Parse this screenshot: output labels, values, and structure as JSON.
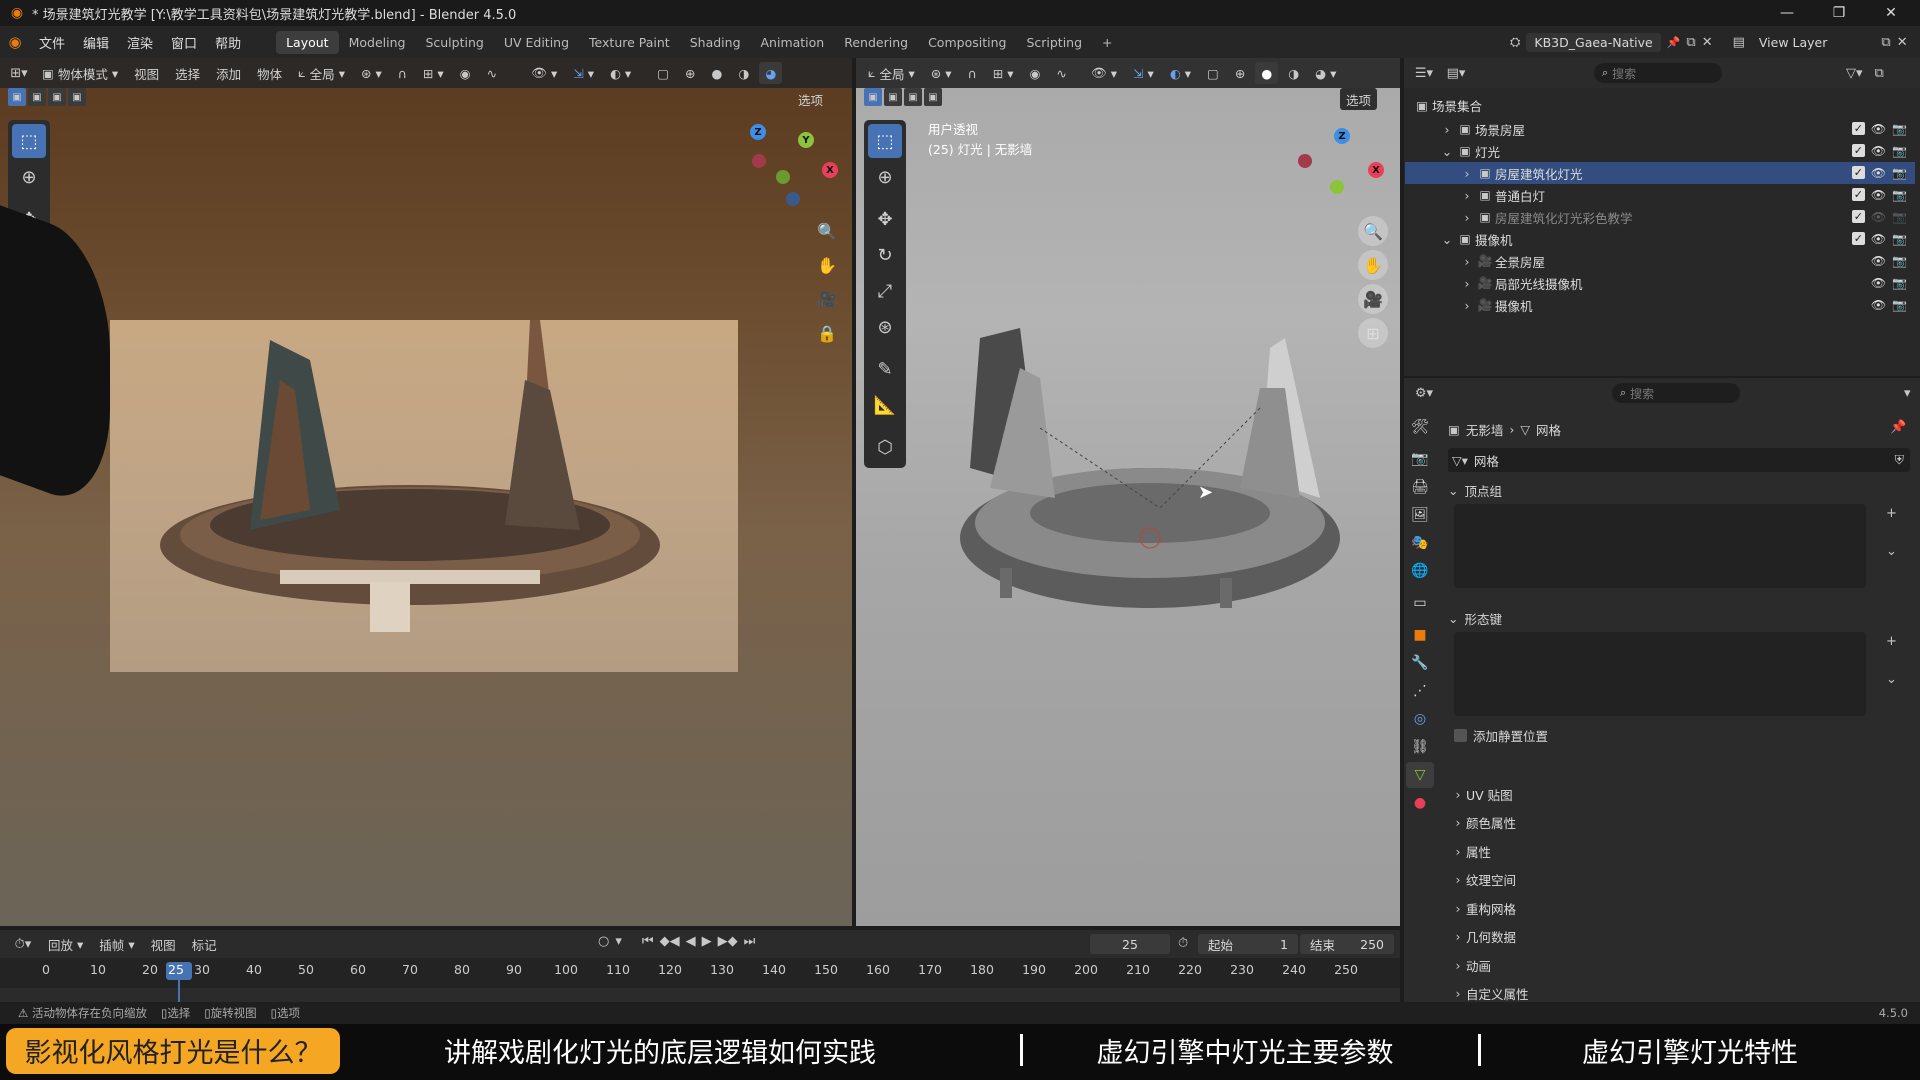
{
  "window": {
    "title": "* 场景建筑灯光教学 [Y:\\教学工具资料包\\场景建筑灯光教学.blend] - Blender 4.5.0",
    "minimize": "—",
    "maximize": "❐",
    "close": "✕"
  },
  "menu": {
    "items": [
      "文件",
      "编辑",
      "渲染",
      "窗口",
      "帮助"
    ],
    "workspaces": [
      "Layout",
      "Modeling",
      "Sculpting",
      "UV Editing",
      "Texture Paint",
      "Shading",
      "Animation",
      "Rendering",
      "Compositing",
      "Scripting"
    ],
    "add_tab": "+",
    "scene": "KB3D_Gaea-Native",
    "view_layer": "View Layer"
  },
  "viewport_left": {
    "mode": "物体模式",
    "menus": [
      "视图",
      "选择",
      "添加",
      "物体"
    ],
    "transform": "全局",
    "options": "选项"
  },
  "viewport_right": {
    "transform": "全局",
    "options": "选项",
    "view_name": "用户透视",
    "view_info": "(25) 灯光 | 无影墙"
  },
  "outliner": {
    "search_placeholder": "搜索",
    "root": "场景集合",
    "rows": [
      {
        "label": "场景房屋",
        "selected": false
      },
      {
        "label": "灯光",
        "selected": false
      },
      {
        "label": "房屋建筑化灯光",
        "selected": true
      },
      {
        "label": "普通白灯",
        "selected": false
      },
      {
        "label": "房屋建筑化灯光彩色教学",
        "selected": false
      },
      {
        "label": "摄像机",
        "selected": false
      },
      {
        "label": "全景房屋",
        "selected": false
      },
      {
        "label": "局部光线摄像机",
        "selected": false
      },
      {
        "label": "摄像机",
        "selected": false
      }
    ]
  },
  "properties": {
    "search_placeholder": "搜索",
    "breadcrumb_object": "无影墙",
    "breadcrumb_data": "网格",
    "data_name": "网格",
    "vertex_groups": "顶点组",
    "shape_keys": "形态键",
    "add_rest_position": "添加静置位置",
    "panels": [
      "UV 贴图",
      "颜色属性",
      "属性",
      "纹理空间",
      "重构网格",
      "几何数据",
      "动画",
      "自定义属性"
    ]
  },
  "timeline": {
    "menus": [
      "回放",
      "插帧",
      "视图",
      "标记"
    ],
    "current_frame": "25",
    "start_label": "起始",
    "start": "1",
    "end_label": "结束",
    "end": "250",
    "ticks": [
      "0",
      "10",
      "20",
      "25",
      "30",
      "40",
      "50",
      "60",
      "70",
      "80",
      "90",
      "100",
      "110",
      "120",
      "130",
      "140",
      "150",
      "160",
      "170",
      "180",
      "190",
      "200",
      "210",
      "220",
      "230",
      "240",
      "250"
    ]
  },
  "statusbar": {
    "items": [
      "活动物体存在负向缩放",
      "选择",
      "旋转视图",
      "选项"
    ],
    "version": "4.5.0"
  },
  "subtitles": [
    "影视化风格打光是什么？",
    "讲解戏剧化灯光的底层逻辑如何实践",
    "虚幻引擎中灯光主要参数",
    "虚幻引擎灯光特性"
  ],
  "colors": {
    "accent": "#4772b3",
    "subtitle_highlight": "#f5a623",
    "axis_x": "#e8405a",
    "axis_y": "#8bc43a",
    "axis_z": "#3d8ee6"
  }
}
